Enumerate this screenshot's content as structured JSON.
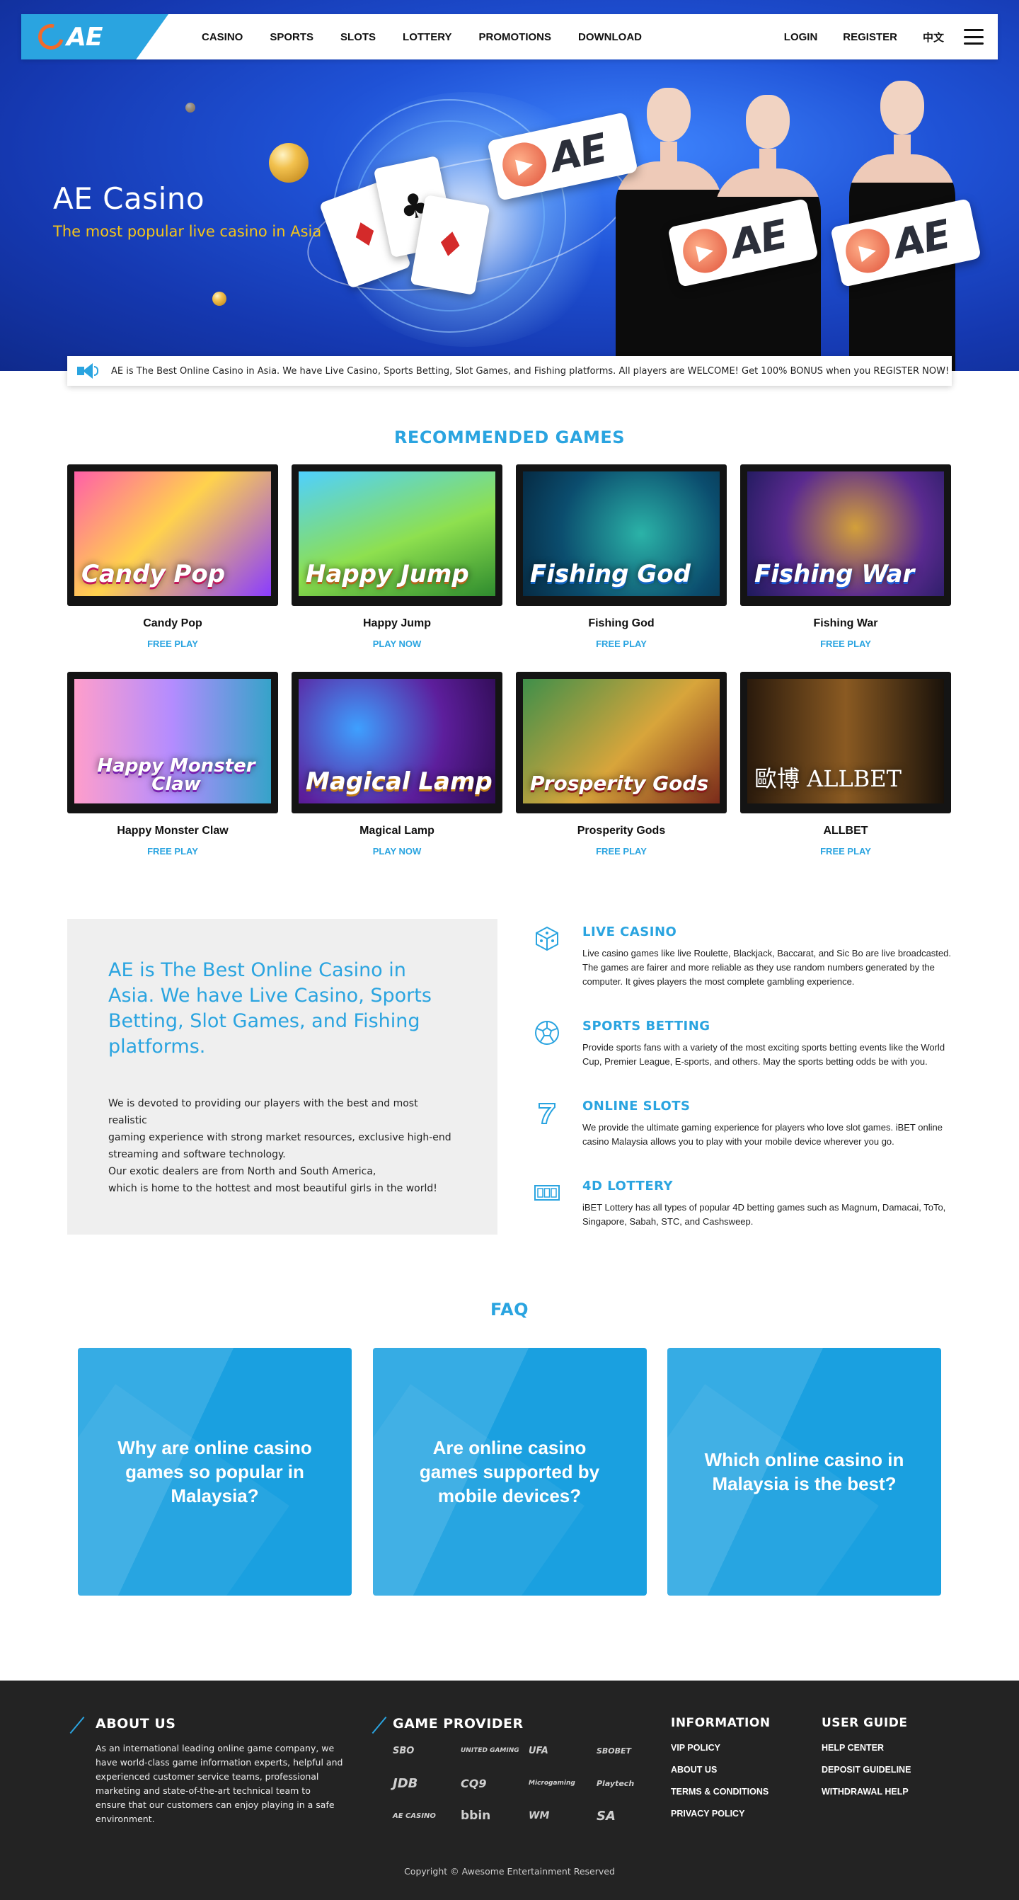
{
  "nav": {
    "logo_text": "AE",
    "menu": [
      "CASINO",
      "SPORTS",
      "SLOTS",
      "LOTTERY",
      "PROMOTIONS",
      "DOWNLOAD"
    ],
    "login": "LOGIN",
    "register": "REGISTER",
    "language": "中文"
  },
  "hero": {
    "title": "AE Casino",
    "subtitle": "The most popular live casino in Asia",
    "sign_text": "AE"
  },
  "marquee": {
    "text": "AE is The Best Online Casino in Asia. We have Live Casino, Sports Betting, Slot Games, and Fishing platforms. All players are WELCOME! Get 100% BONUS when you REGISTER NOW!"
  },
  "recommended": {
    "title": "RECOMMENDED GAMES",
    "games": [
      {
        "name": "Candy Pop",
        "cta": "FREE PLAY",
        "art": "Candy Pop"
      },
      {
        "name": "Happy Jump",
        "cta": "PLAY NOW",
        "art": "Happy Jump"
      },
      {
        "name": "Fishing God",
        "cta": "FREE PLAY",
        "art": "Fishing God"
      },
      {
        "name": "Fishing War",
        "cta": "FREE PLAY",
        "art": "Fishing War"
      },
      {
        "name": "Happy Monster Claw",
        "cta": "FREE PLAY",
        "art": "Happy Monster Claw"
      },
      {
        "name": "Magical Lamp",
        "cta": "PLAY NOW",
        "art": "Magical Lamp"
      },
      {
        "name": "Prosperity Gods",
        "cta": "FREE PLAY",
        "art": "Prosperity Gods"
      },
      {
        "name": "ALLBET",
        "cta": "FREE PLAY",
        "art": "歐博 ALLBET"
      }
    ]
  },
  "about": {
    "headline": "AE is The Best Online Casino in Asia. We have Live Casino, Sports Betting, Slot Games, and Fishing platforms.",
    "body_lines": [
      "We is devoted to providing our players with the best and most realistic",
      "gaming experience with strong market resources, exclusive high-end",
      "streaming and software technology.",
      "Our exotic dealers are from North and South America,",
      "which is home to the hottest and most beautiful girls in the world!"
    ]
  },
  "features": [
    {
      "icon": "dice-icon",
      "title": "LIVE CASINO",
      "text": "Live casino games like live Roulette, Blackjack, Baccarat, and Sic Bo are live broadcasted. The games are fairer and more reliable as they use random numbers generated by the computer. It gives players the most complete gambling experience."
    },
    {
      "icon": "soccer-ball-icon",
      "title": "SPORTS BETTING",
      "text": "Provide sports fans with a variety of the most exciting sports betting events like the World Cup, Premier League, E-sports, and others. May the sports betting odds be with you."
    },
    {
      "icon": "lucky-seven-icon",
      "title": "ONLINE SLOTS",
      "text": "We provide the ultimate gaming experience for players who love slot games. iBET online casino Malaysia allows you to play with your mobile device wherever you go."
    },
    {
      "icon": "lottery-ticket-icon",
      "title": "4D LOTTERY",
      "text": "iBET Lottery has all types of popular 4D betting games such as Magnum, Damacai, ToTo, Singapore, Sabah, STC, and Cashsweep."
    }
  ],
  "faq": {
    "title": "FAQ",
    "questions": [
      "Why are online casino games so popular in Malaysia?",
      "Are online casino games supported by mobile devices?",
      "Which online casino in Malaysia is the best?"
    ]
  },
  "footer": {
    "about_title": "ABOUT US",
    "about_text": "As an international leading online game company, we have world-class game information experts, helpful and experienced customer service teams, professional marketing and state-of-the-art technical team to ensure that our customers can enjoy playing in a safe environment.",
    "provider_title": "GAME PROVIDER",
    "providers": [
      "SBO",
      "UNITED GAMING",
      "UFA",
      "SBOBET",
      "JDB",
      "CQ9",
      "Microgaming",
      "Playtech",
      "AE CASINO",
      "bbin",
      "WM",
      "SA"
    ],
    "info_title": "INFORMATION",
    "info_links": [
      "VIP POLICY",
      "ABOUT US",
      "TERMS & CONDITIONS",
      "PRIVACY POLICY"
    ],
    "guide_title": "USER GUIDE",
    "guide_links": [
      "HELP CENTER",
      "DEPOSIT GUIDELINE",
      "WITHDRAWAL HELP"
    ],
    "copyright": "Copyright © Awesome Entertainment Reserved"
  },
  "colors": {
    "accent": "#2aa4e0",
    "hero_yellow": "#f5c518",
    "footer_bg": "#232323",
    "faq_card": "#1aa0e0"
  }
}
